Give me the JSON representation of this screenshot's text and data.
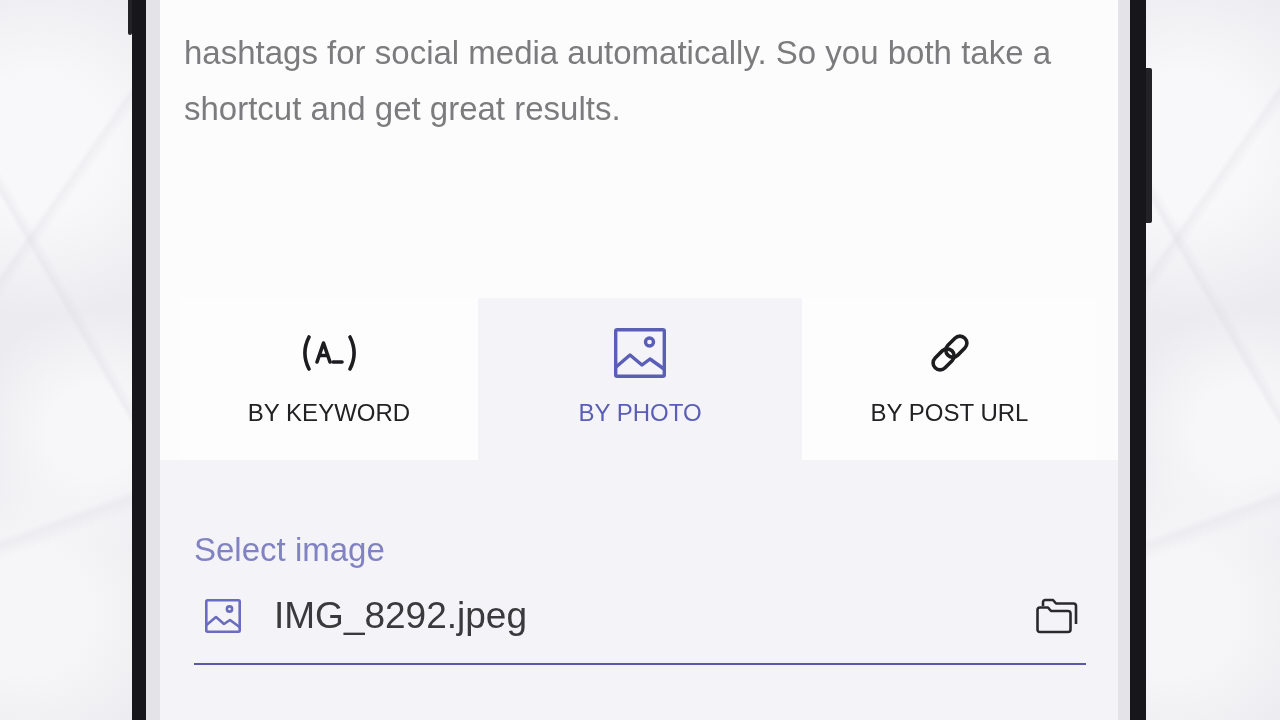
{
  "description": {
    "text": "hashtags for social media automatically. So you both take a shortcut and get great results."
  },
  "tabs": [
    {
      "label": "BY KEYWORD",
      "kind": "keyword",
      "selected": false
    },
    {
      "label": "BY PHOTO",
      "kind": "photo",
      "selected": true
    },
    {
      "label": "BY POST URL",
      "kind": "link",
      "selected": false
    }
  ],
  "image_field": {
    "label": "Select image",
    "value": "IMG_8292.jpeg"
  }
}
